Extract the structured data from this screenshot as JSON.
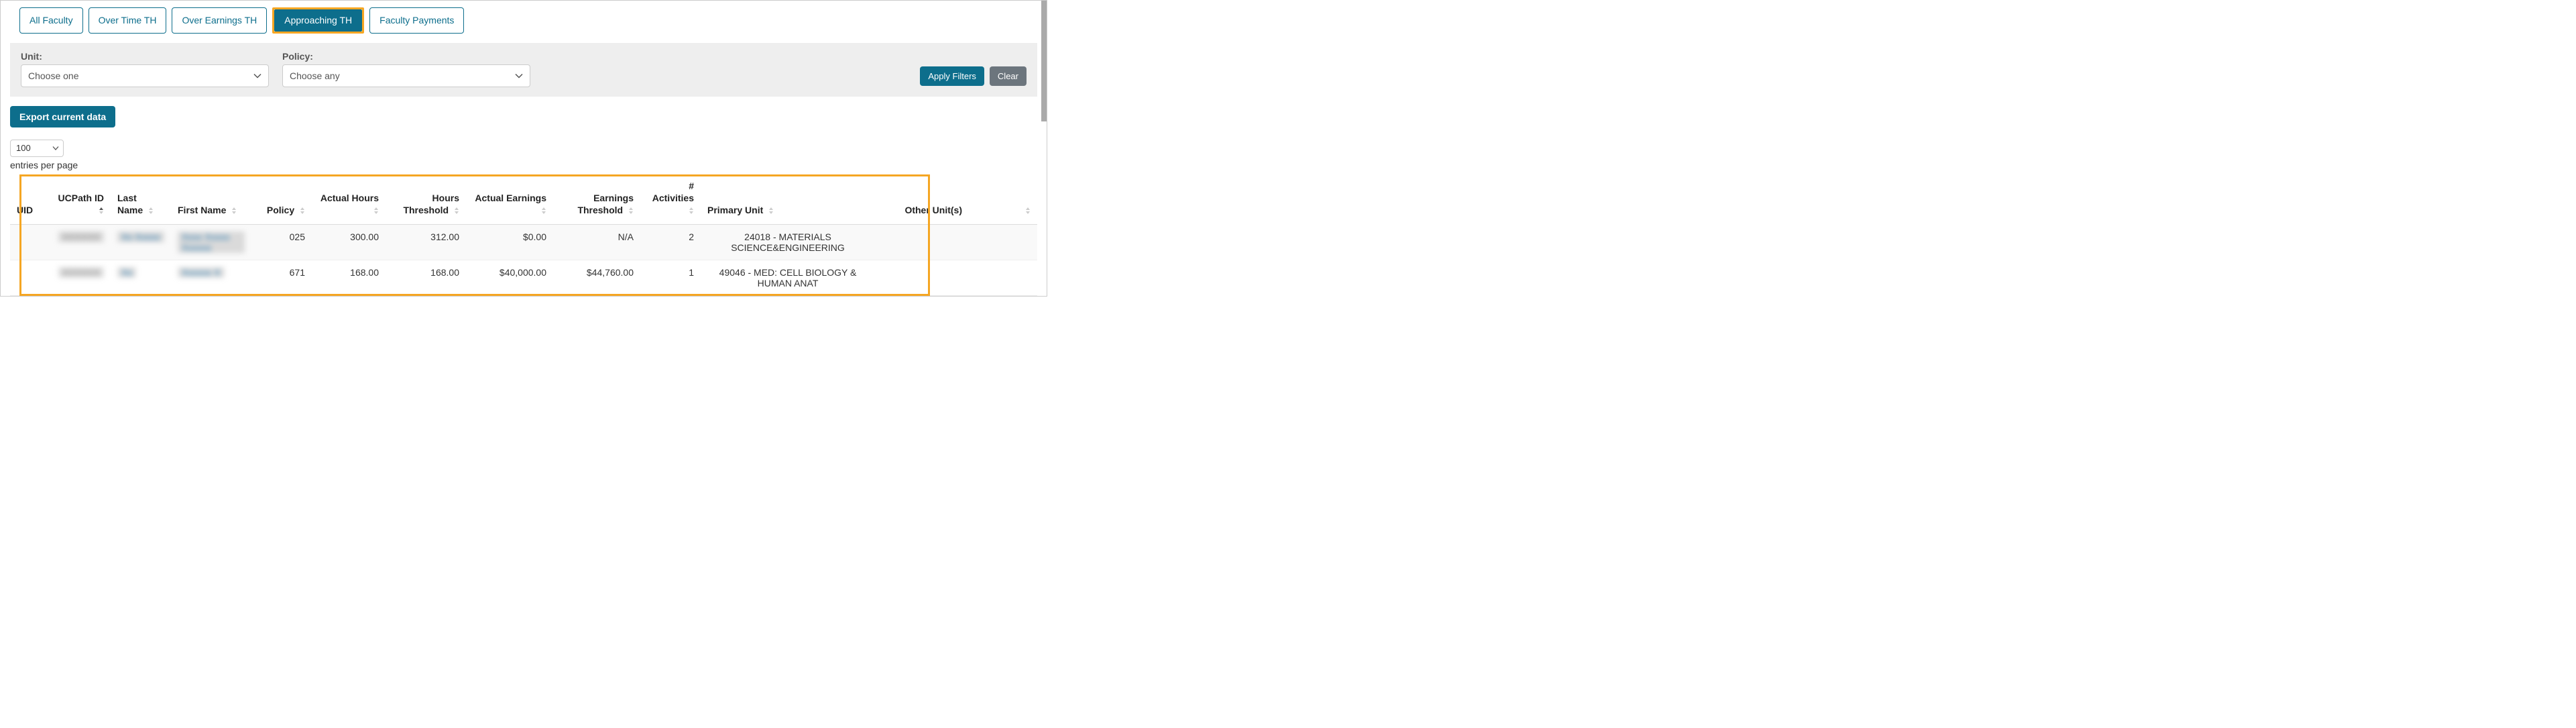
{
  "tabs": {
    "all_faculty": "All Faculty",
    "over_time": "Over Time TH",
    "over_earnings": "Over Earnings TH",
    "approaching": "Approaching TH",
    "faculty_payments": "Faculty Payments"
  },
  "filters": {
    "unit_label": "Unit:",
    "unit_placeholder": "Choose one",
    "policy_label": "Policy:",
    "policy_placeholder": "Choose any",
    "apply_label": "Apply Filters",
    "clear_label": "Clear"
  },
  "export_label": "Export current data",
  "page_size": {
    "value": "100",
    "entries_label": "entries per page"
  },
  "table": {
    "headers": {
      "uid": "UID",
      "ucpath": "UCPath ID",
      "last": "Last Name",
      "first": "First Name",
      "policy": "Policy",
      "hours": "Actual Hours",
      "hours_th": "Hours Threshold",
      "earnings": "Actual Earnings",
      "earnings_th": "Earnings Threshold",
      "activities": "# Activities",
      "primary": "Primary Unit",
      "other": "Other Unit(s)"
    },
    "rows": [
      {
        "uid": "",
        "ucpath": "XXXXXX",
        "last": "Xx Xxxxx",
        "first": "Xxxx Xxxxx Xxxxxx",
        "policy": "025",
        "hours": "300.00",
        "hours_th": "312.00",
        "earnings": "$0.00",
        "earnings_th": "N/A",
        "activities": "2",
        "primary": "24018 - MATERIALS SCIENCE&ENGINEERING",
        "other": ""
      },
      {
        "uid": "",
        "ucpath": "XXXXXX",
        "last": "Xx",
        "first": "Xxxxxx X",
        "policy": "671",
        "hours": "168.00",
        "hours_th": "168.00",
        "earnings": "$40,000.00",
        "earnings_th": "$44,760.00",
        "activities": "1",
        "primary": "49046 - MED: CELL BIOLOGY & HUMAN ANAT",
        "other": ""
      }
    ]
  }
}
